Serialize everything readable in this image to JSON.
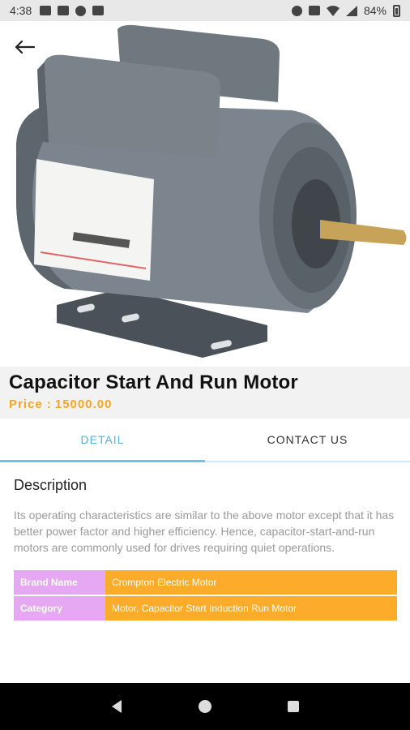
{
  "status_bar": {
    "time": "4:38",
    "battery": "84%"
  },
  "product": {
    "title": "Capacitor Start And Run Motor",
    "price_label": "Price :",
    "price_value": "15000.00"
  },
  "tabs": [
    {
      "label": "DETAIL",
      "active": true
    },
    {
      "label": "CONTACT US",
      "active": false
    }
  ],
  "detail": {
    "heading": "Description",
    "text": "Its operating characteristics are similar to the above motor except that it has better power factor and higher efficiency. Hence, capacitor-start-and-run motors are commonly used for drives requiring quiet operations.",
    "specs": [
      {
        "key": "Brand Name",
        "value": "Crompton Electric Motor"
      },
      {
        "key": "Category",
        "value": "Motor, Capacitor Start Induction Run Motor"
      }
    ]
  },
  "colors": {
    "accent": "#4fb3e6",
    "price": "#f5a623",
    "spec_key": "#e6a8f2",
    "spec_value": "#fdab2a"
  },
  "icons": {
    "back": "arrow-left-icon",
    "nav_back": "triangle-back-icon",
    "nav_home": "circle-home-icon",
    "nav_recents": "square-recents-icon"
  }
}
